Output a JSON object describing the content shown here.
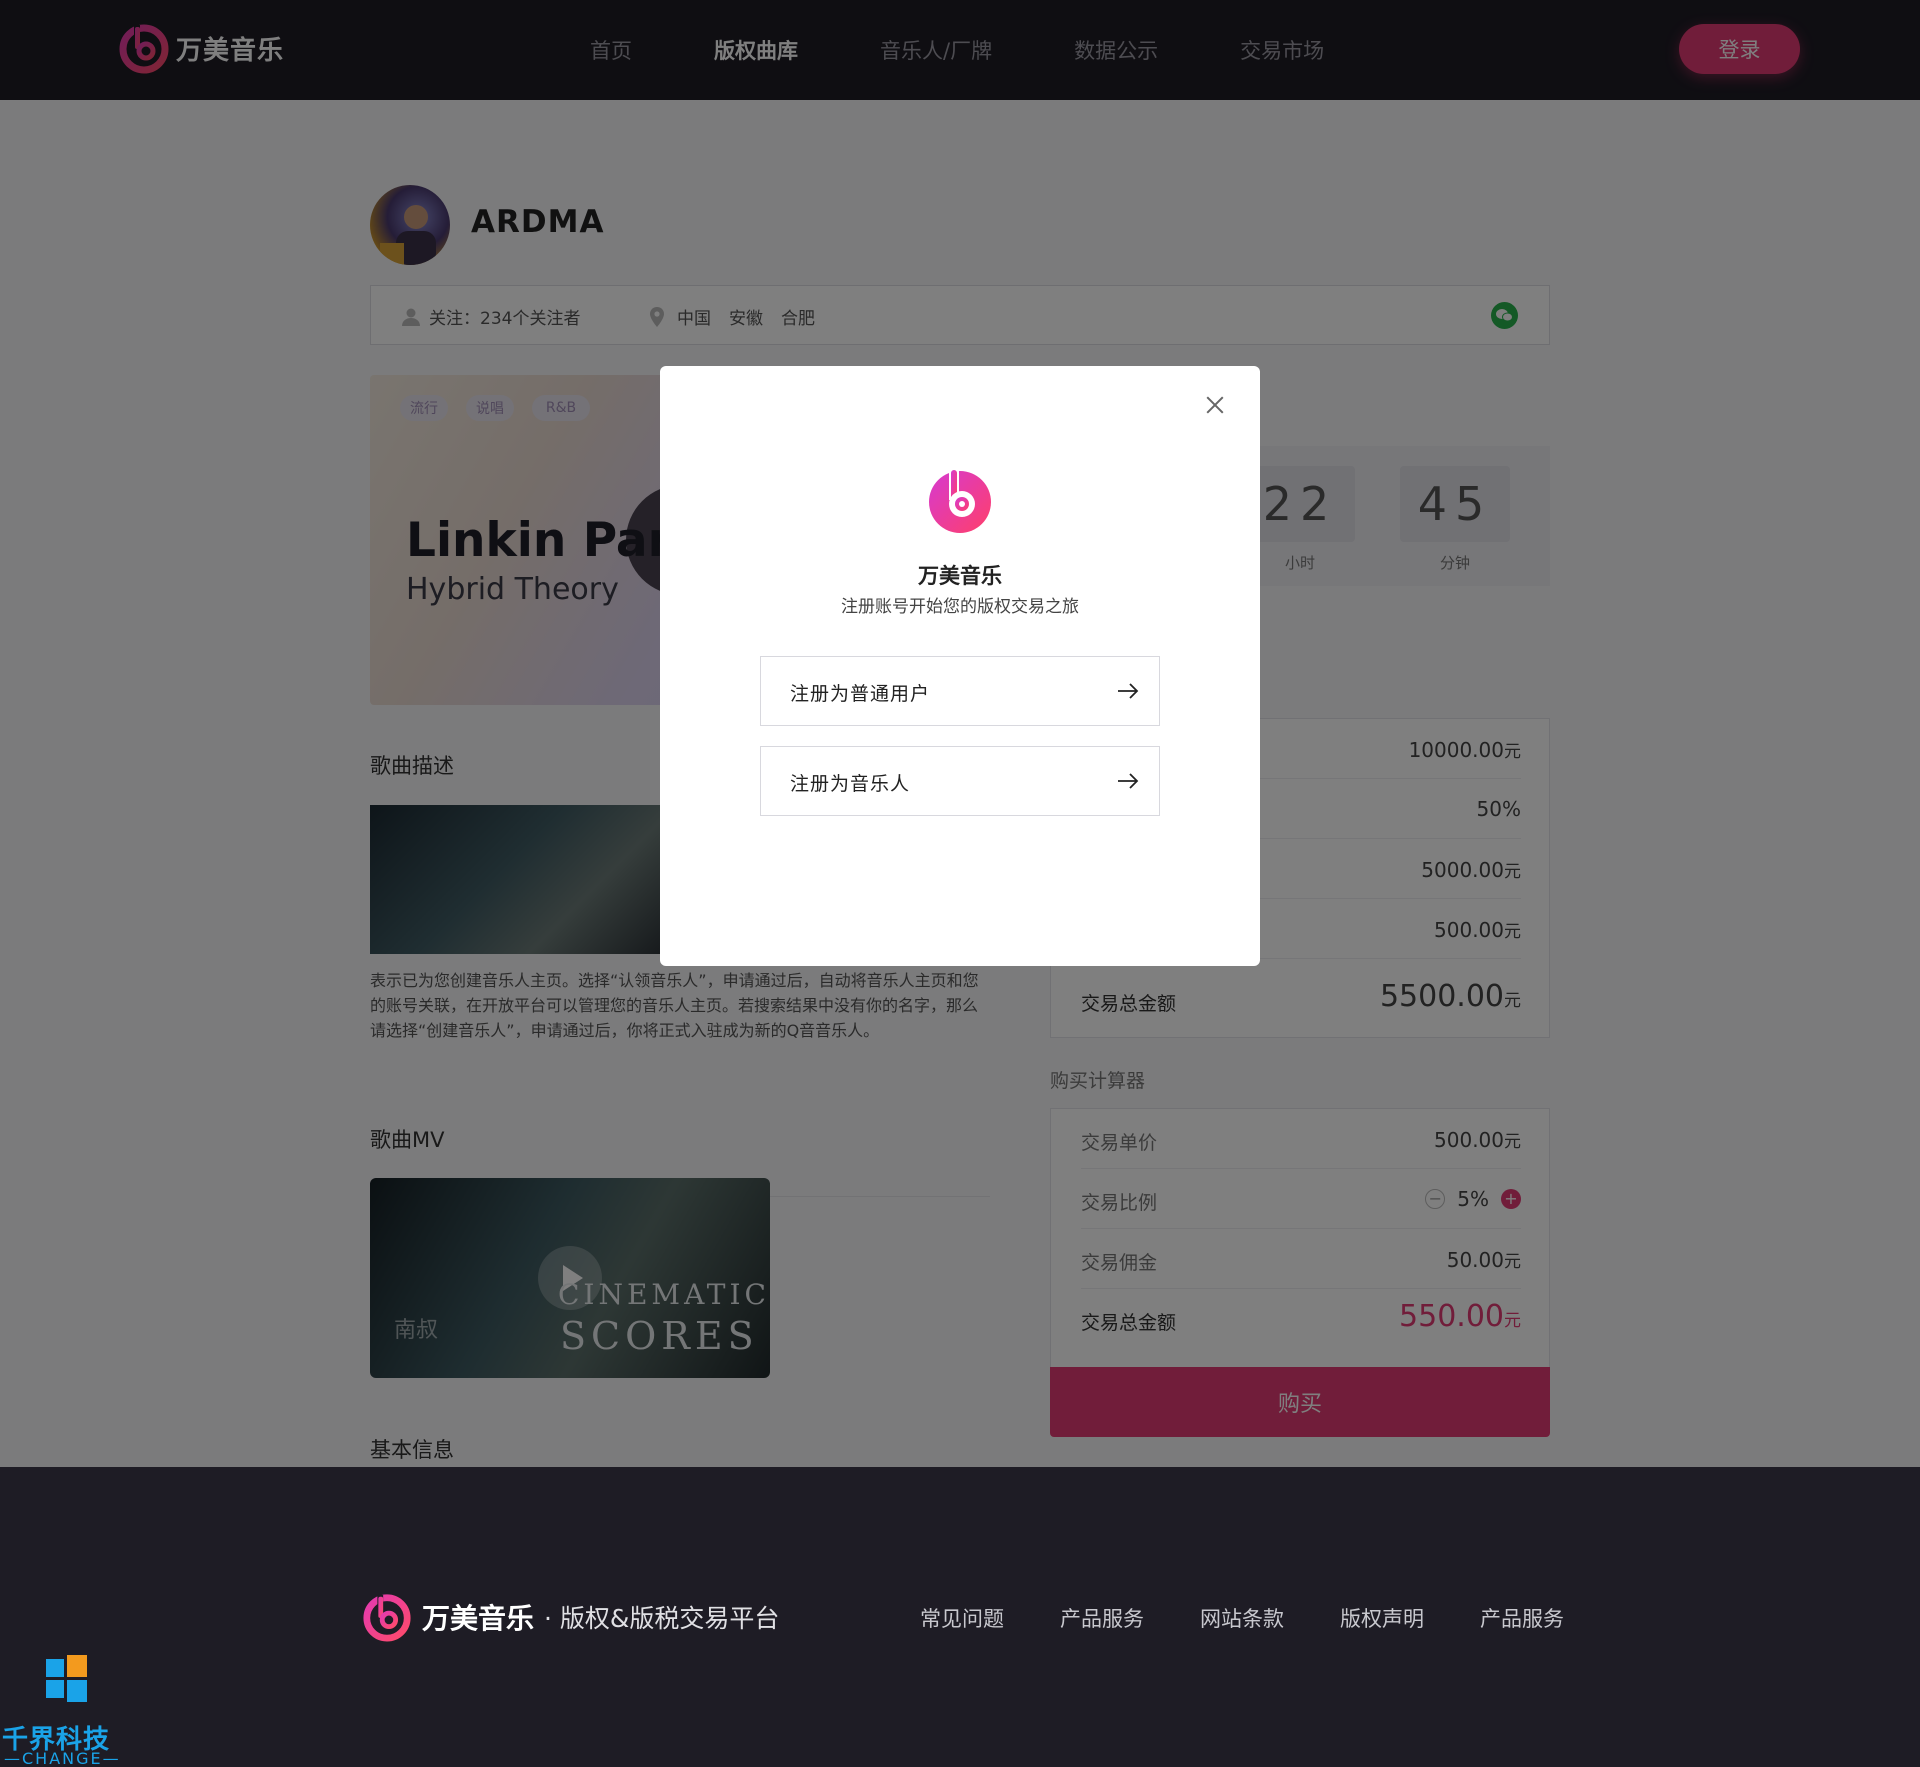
{
  "header": {
    "logo_text": "万美音乐",
    "nav": [
      "首页",
      "版权曲库",
      "音乐人/厂牌",
      "数据公示",
      "交易市场"
    ],
    "active_nav": "版权曲库",
    "login_label": "登录"
  },
  "artist": {
    "name": "ARDMA",
    "follow_label": "关注：234个关注者",
    "location": [
      "中国",
      "安徽",
      "合肥"
    ]
  },
  "album": {
    "tags": [
      "流行",
      "说唱",
      "R&B"
    ],
    "title": "Linkin Park",
    "subtitle": "Hybrid Theory"
  },
  "sections": {
    "description_title": "歌曲描述",
    "description_text": "表示已为您创建音乐人主页。选择“认领音乐人”，申请通过后，自动将音乐人主页和您的账号关联，在开放平台可以管理您的音乐人主页。若搜索结果中没有你的名字，那么请选择“创建音乐人”，申请通过后，你将正式入驻成为新的Q音音乐人。",
    "mv_title": "歌曲MV",
    "mv_overlay_line1": "CINEMATIC",
    "mv_overlay_line2": "SCORES",
    "mv_watermark": "南叔",
    "basic_info_title": "基本信息"
  },
  "countdown": {
    "hours": "22",
    "hours_unit": "小时",
    "minutes": "45",
    "minutes_unit": "分钟"
  },
  "price_panel": {
    "values": [
      "10000.00",
      "50%",
      "5000.00",
      "500.00"
    ],
    "total_label": "交易总金额",
    "total_value": "5500.00",
    "unit": "元"
  },
  "calculator": {
    "title": "购买计算器",
    "unit_price_label": "交易单价",
    "unit_price_value": "500.00",
    "ratio_label": "交易比例",
    "ratio_value": "5%",
    "ratio_minus": "−",
    "ratio_plus": "+",
    "commission_label": "交易佣金",
    "commission_value": "50.00",
    "total_label": "交易总金额",
    "total_value": "550.00",
    "unit": "元",
    "buy_label": "购买"
  },
  "footer": {
    "logo_text": "万美音乐",
    "tagline": "· 版权&版税交易平台",
    "links": [
      "常见问题",
      "产品服务",
      "网站条款",
      "版权声明",
      "产品服务"
    ]
  },
  "watermark": {
    "text": "千界科技",
    "sub": "—CHANGE—"
  },
  "modal": {
    "title": "万美音乐",
    "subtitle": "注册账号开始您的版权交易之旅",
    "options": [
      "注册为普通用户",
      "注册为音乐人"
    ]
  },
  "colors": {
    "accent": "#e33a74",
    "header_bg": "#1e1c25",
    "wechat": "#29b24d"
  }
}
